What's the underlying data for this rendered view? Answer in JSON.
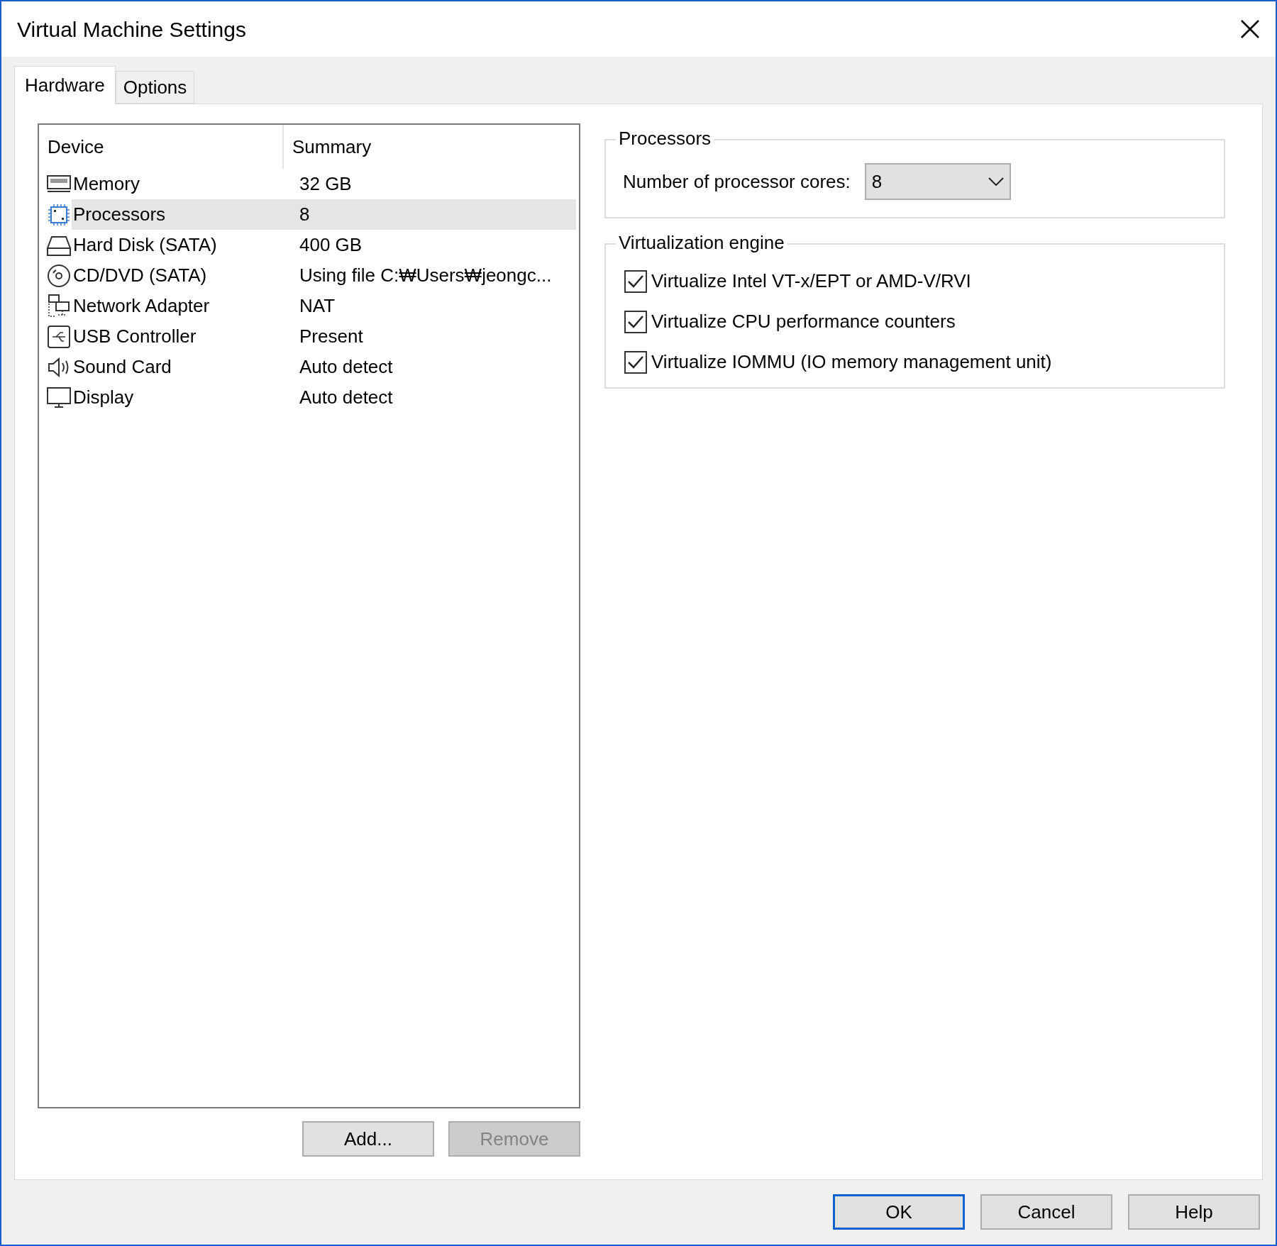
{
  "window": {
    "title": "Virtual Machine Settings"
  },
  "tabs": [
    {
      "label": "Hardware",
      "selected": true
    },
    {
      "label": "Options",
      "selected": false
    }
  ],
  "device_list": {
    "columns": [
      "Device",
      "Summary"
    ],
    "rows": [
      {
        "kind": "memory",
        "device": "Memory",
        "summary": "32 GB",
        "selected": false
      },
      {
        "kind": "processor",
        "device": "Processors",
        "summary": "8",
        "selected": true
      },
      {
        "kind": "disk",
        "device": "Hard Disk (SATA)",
        "summary": "400 GB",
        "selected": false
      },
      {
        "kind": "cd",
        "device": "CD/DVD (SATA)",
        "summary": "Using file C:₩Users₩jeongc...",
        "selected": false
      },
      {
        "kind": "network",
        "device": "Network Adapter",
        "summary": "NAT",
        "selected": false
      },
      {
        "kind": "usb",
        "device": "USB Controller",
        "summary": "Present",
        "selected": false
      },
      {
        "kind": "sound",
        "device": "Sound Card",
        "summary": "Auto detect",
        "selected": false
      },
      {
        "kind": "display",
        "device": "Display",
        "summary": "Auto detect",
        "selected": false
      }
    ]
  },
  "list_buttons": [
    {
      "label": "Add...",
      "disabled": false
    },
    {
      "label": "Remove",
      "disabled": true
    }
  ],
  "processors": {
    "title": "Processors",
    "label": "Number of processor cores:",
    "value": "8"
  },
  "virtualization": {
    "title": "Virtualization engine",
    "options": [
      {
        "label": "Virtualize Intel VT-x/EPT or AMD-V/RVI",
        "checked": true
      },
      {
        "label": "Virtualize CPU performance counters",
        "checked": true
      },
      {
        "label": "Virtualize IOMMU (IO memory management unit)",
        "checked": true
      }
    ]
  },
  "buttons": [
    {
      "label": "OK",
      "default": true
    },
    {
      "label": "Cancel",
      "default": false
    },
    {
      "label": "Help",
      "default": false
    }
  ]
}
